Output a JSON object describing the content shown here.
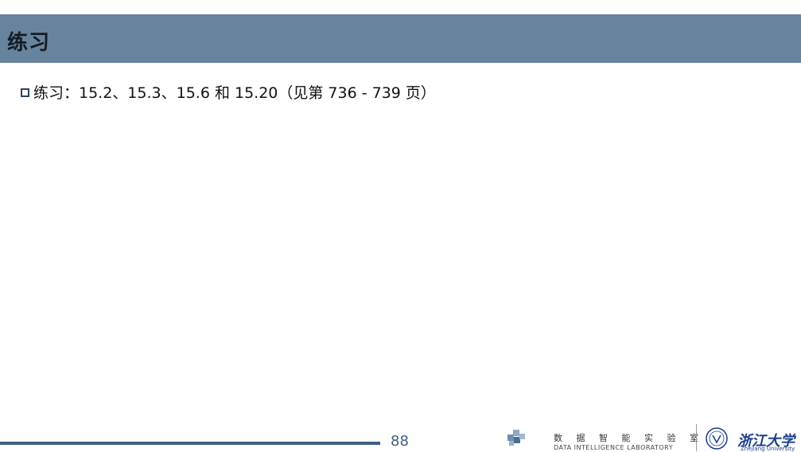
{
  "slide": {
    "title": "练习",
    "bullets": [
      "练习：15.2、15.3、15.6 和 15.20（见第 736 - 739 页）"
    ]
  },
  "footer": {
    "page_number": "88",
    "lab_name_cn": "数 据 智 能 实 验 室",
    "lab_name_en": "DATA INTELLIGENCE LABORATORY",
    "university_cn": "浙江大学",
    "university_en": "Zhejiang University",
    "lab_logo_icon": "cube-cluster-icon",
    "university_emblem_icon": "zju-emblem-icon"
  },
  "colors": {
    "title_bar": "#67849f",
    "footer_rule": "#3f5f80",
    "university_blue": "#1a3f8a"
  }
}
